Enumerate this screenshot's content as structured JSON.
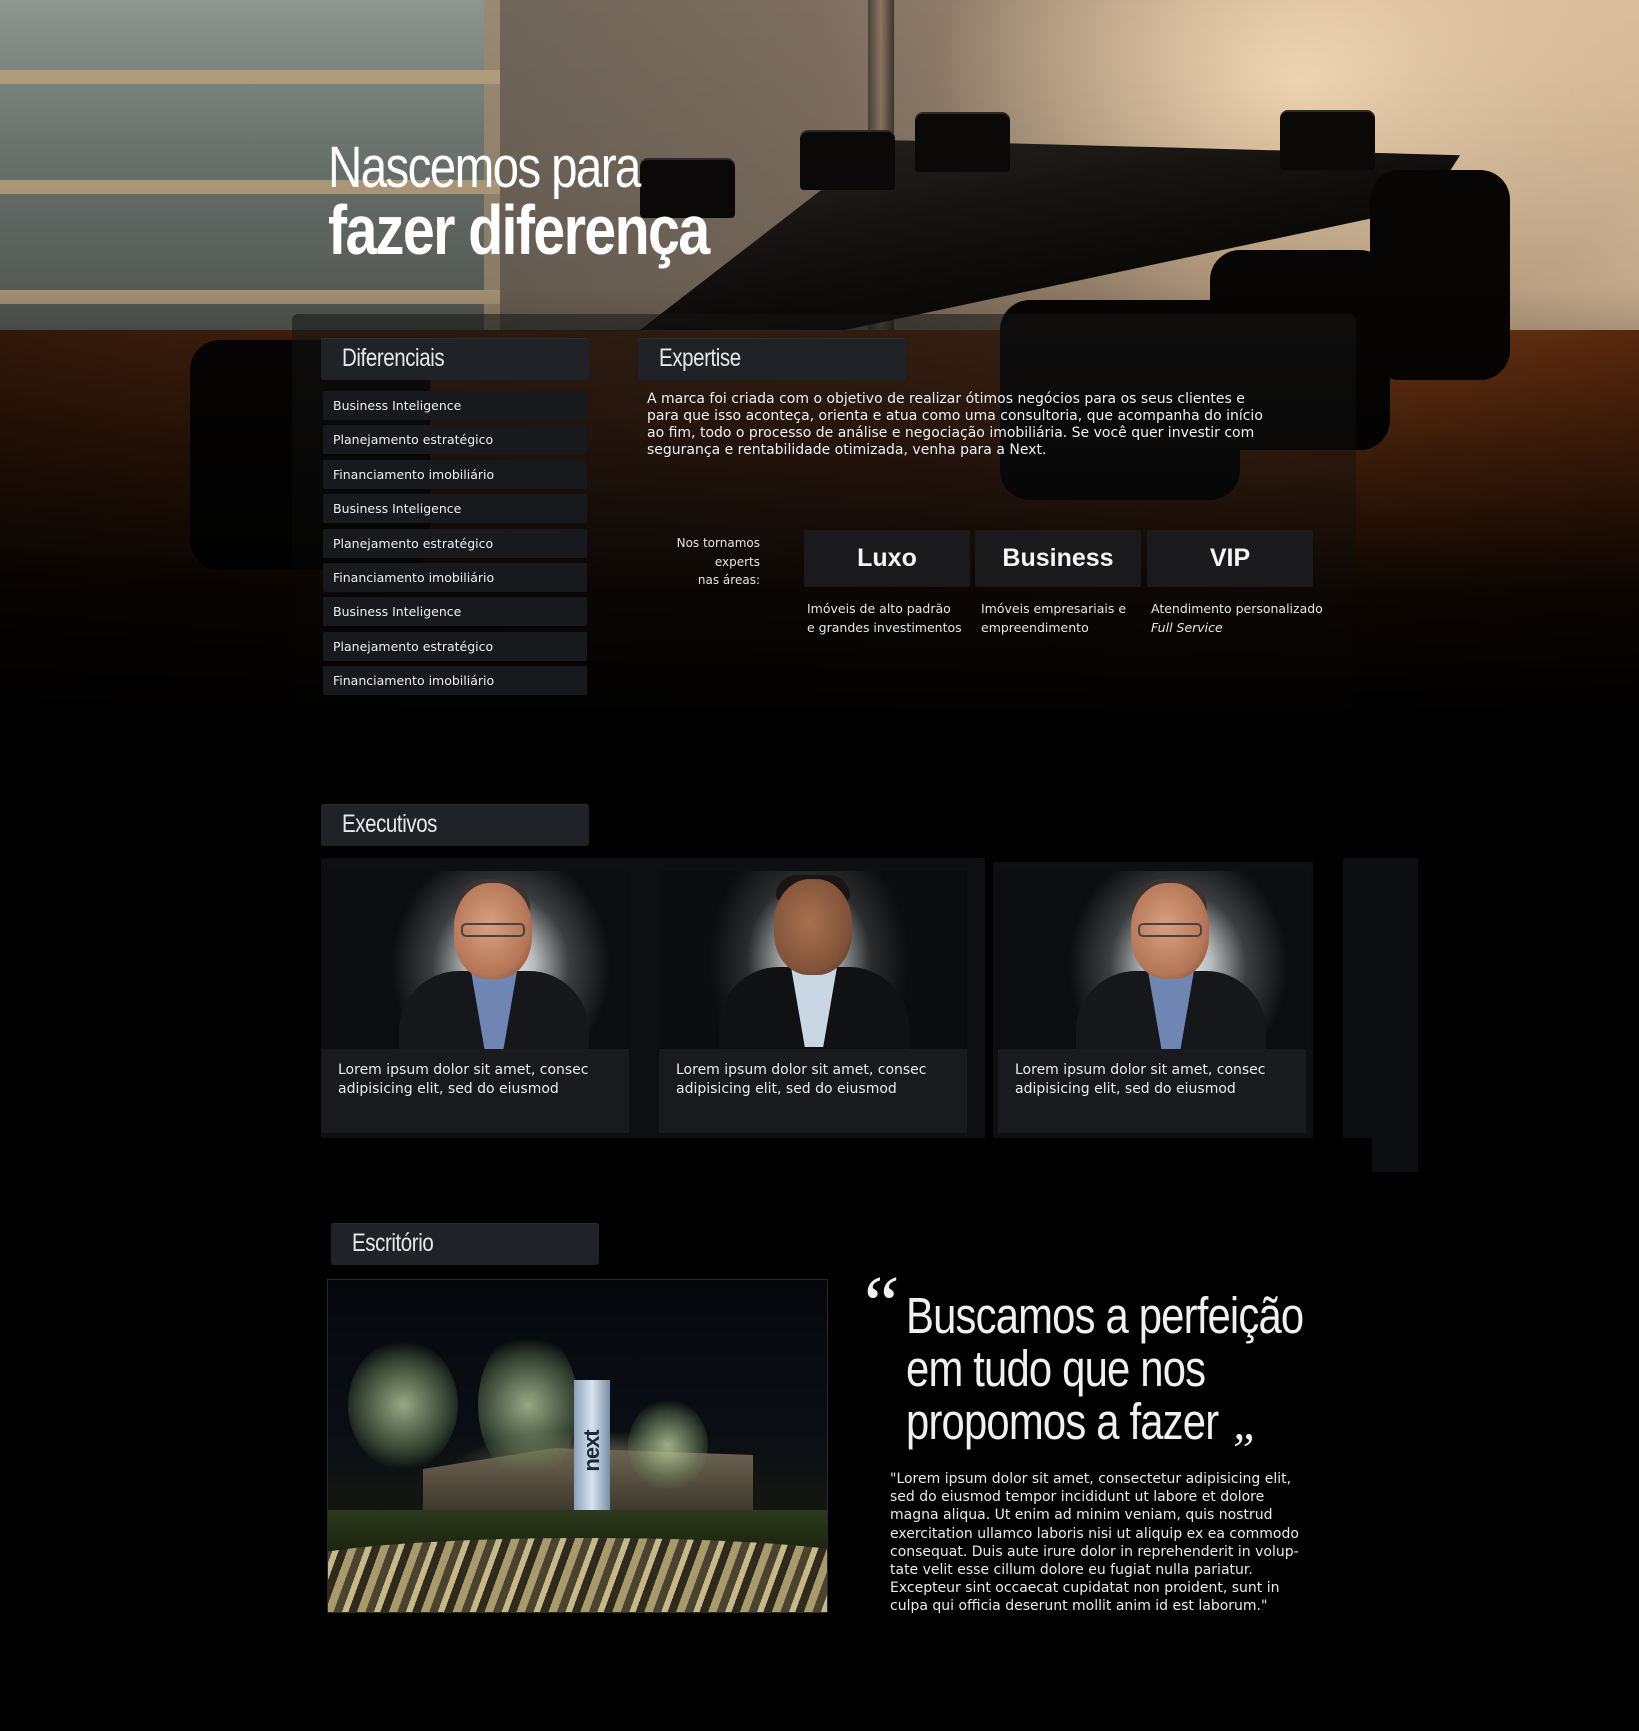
{
  "hero": {
    "title_line1": "Nascemos para",
    "title_line2": "fazer diferença"
  },
  "diferenciais": {
    "title": "Diferenciais",
    "items": [
      {
        "label": "Business Inteligence"
      },
      {
        "label": "Planejamento estratégico"
      },
      {
        "label": "Financiamento imobiliário"
      },
      {
        "label": "Business Inteligence"
      },
      {
        "label": "Planejamento estratégico"
      },
      {
        "label": "Financiamento imobiliário"
      },
      {
        "label": "Business Inteligence"
      },
      {
        "label": "Planejamento estratégico"
      },
      {
        "label": "Financiamento imobiliário"
      }
    ]
  },
  "expertise": {
    "title": "Expertise",
    "text": "A marca foi criada com o objetivo de realizar ótimos negócios para os seus clientes e para que isso aconteça, orienta e atua como uma consultoria, que acompanha do início ao fim, todo o processo de análise e negociação imobiliária. Se você quer investir com segurança e rentabilidade otimizada, venha para a Next.",
    "experts_line1": "Nos tornamos",
    "experts_line2": "experts",
    "experts_line3": "nas áreas:",
    "areas": [
      {
        "name": "Luxo",
        "desc_line1": "Imóveis de alto padrão",
        "desc_line2": "e grandes investimentos"
      },
      {
        "name": "Business",
        "desc_line1": "Imóveis empresariais e",
        "desc_line2": "empreendimento"
      },
      {
        "name": "VIP",
        "desc_line1": "Atendimento personalizado",
        "desc_line2": "Full Service"
      }
    ]
  },
  "executivos": {
    "title": "Executivos",
    "cards": [
      {
        "caption_line1": "Lorem ipsum dolor sit amet, consec",
        "caption_line2": "adipisicing elit, sed do eiusmod"
      },
      {
        "caption_line1": "Lorem ipsum dolor sit amet, consec",
        "caption_line2": "adipisicing elit, sed do eiusmod"
      },
      {
        "caption_line1": "Lorem ipsum dolor sit amet, consec",
        "caption_line2": "adipisicing elit, sed do eiusmod"
      }
    ]
  },
  "escritorio": {
    "title": "Escritório",
    "photo_sign": "next",
    "quote_line1": "Buscamos a perfeição",
    "quote_line2": "em tudo que nos",
    "quote_line3": "propomos a fazer",
    "quote_open": "“",
    "quote_close": "„",
    "body": "\"Lorem ipsum dolor sit amet, consectetur adipisicing elit, sed do eiusmod tempor incididunt ut labore et dolore magna aliqua. Ut enim ad minim veniam, quis nostrud exercitation ullamco laboris nisi ut aliquip ex ea commodo consequat. Duis aute irure dolor in reprehenderit in volup-tate velit esse cillum dolore eu fugiat nulla pariatur. Excepteur sint occaecat cupidatat non proident, sunt in culpa qui officia deserunt mollit anim id est laborum.\""
  },
  "colors": {
    "background": "#000000",
    "section_title_bg": "#1f2226",
    "list_item_bg": "#17191c",
    "card_bg": "#181a1d",
    "text": "#ffffff"
  }
}
